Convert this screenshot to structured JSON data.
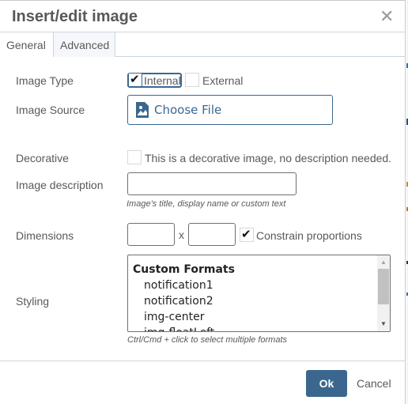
{
  "dialog": {
    "title": "Insert/edit image",
    "close_icon": "close-icon"
  },
  "tabs": [
    {
      "label": "General",
      "active": true
    },
    {
      "label": "Advanced",
      "active": false
    }
  ],
  "form": {
    "image_type": {
      "label": "Image Type",
      "options": [
        {
          "label": "Internal",
          "checked": true
        },
        {
          "label": "External",
          "checked": false
        }
      ]
    },
    "image_source": {
      "label": "Image Source",
      "button_label": "Choose File",
      "icon": "image-file-icon"
    },
    "decorative": {
      "label": "Decorative",
      "checkbox_label": "This is a decorative image, no description needed.",
      "checked": false
    },
    "image_description": {
      "label": "Image description",
      "value": "",
      "hint": "Image's title, display name or custom text"
    },
    "dimensions": {
      "label": "Dimensions",
      "width_value": "",
      "height_value": "",
      "separator": "x",
      "constrain_label": "Constrain proportions",
      "constrain_checked": true
    },
    "styling": {
      "label": "Styling",
      "group_label": "Custom Formats",
      "options": [
        "notification1",
        "notification2",
        "img-center",
        "img-floatLeft"
      ],
      "hint": "Ctrl/Cmd + click to select multiple formats"
    }
  },
  "footer": {
    "ok_label": "Ok",
    "cancel_label": "Cancel"
  },
  "colors": {
    "accent": "#3b678f",
    "text": "#595959",
    "divider": "#ccd6de"
  }
}
